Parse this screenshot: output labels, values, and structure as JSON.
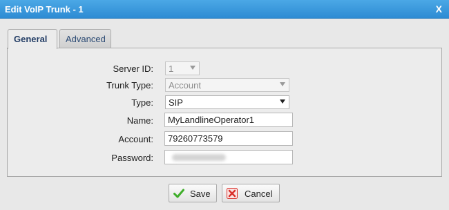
{
  "dialog": {
    "title": "Edit VoIP Trunk - 1",
    "close_label": "X"
  },
  "tabs": [
    {
      "label": "General"
    },
    {
      "label": "Advanced"
    }
  ],
  "form": {
    "server_id": {
      "label": "Server ID:",
      "value": "1"
    },
    "trunk_type": {
      "label": "Trunk Type:",
      "value": "Account"
    },
    "type": {
      "label": "Type:",
      "value": "SIP"
    },
    "name": {
      "label": "Name:",
      "value": "MyLandlineOperator1"
    },
    "account": {
      "label": "Account:",
      "value": "79260773579"
    },
    "password": {
      "label": "Password:",
      "value": ""
    }
  },
  "buttons": {
    "save_label": "Save",
    "cancel_label": "Cancel"
  },
  "colors": {
    "titlebar": "#2d8bd3",
    "save_icon": "#3fae2a",
    "cancel_icon": "#d9312b"
  }
}
